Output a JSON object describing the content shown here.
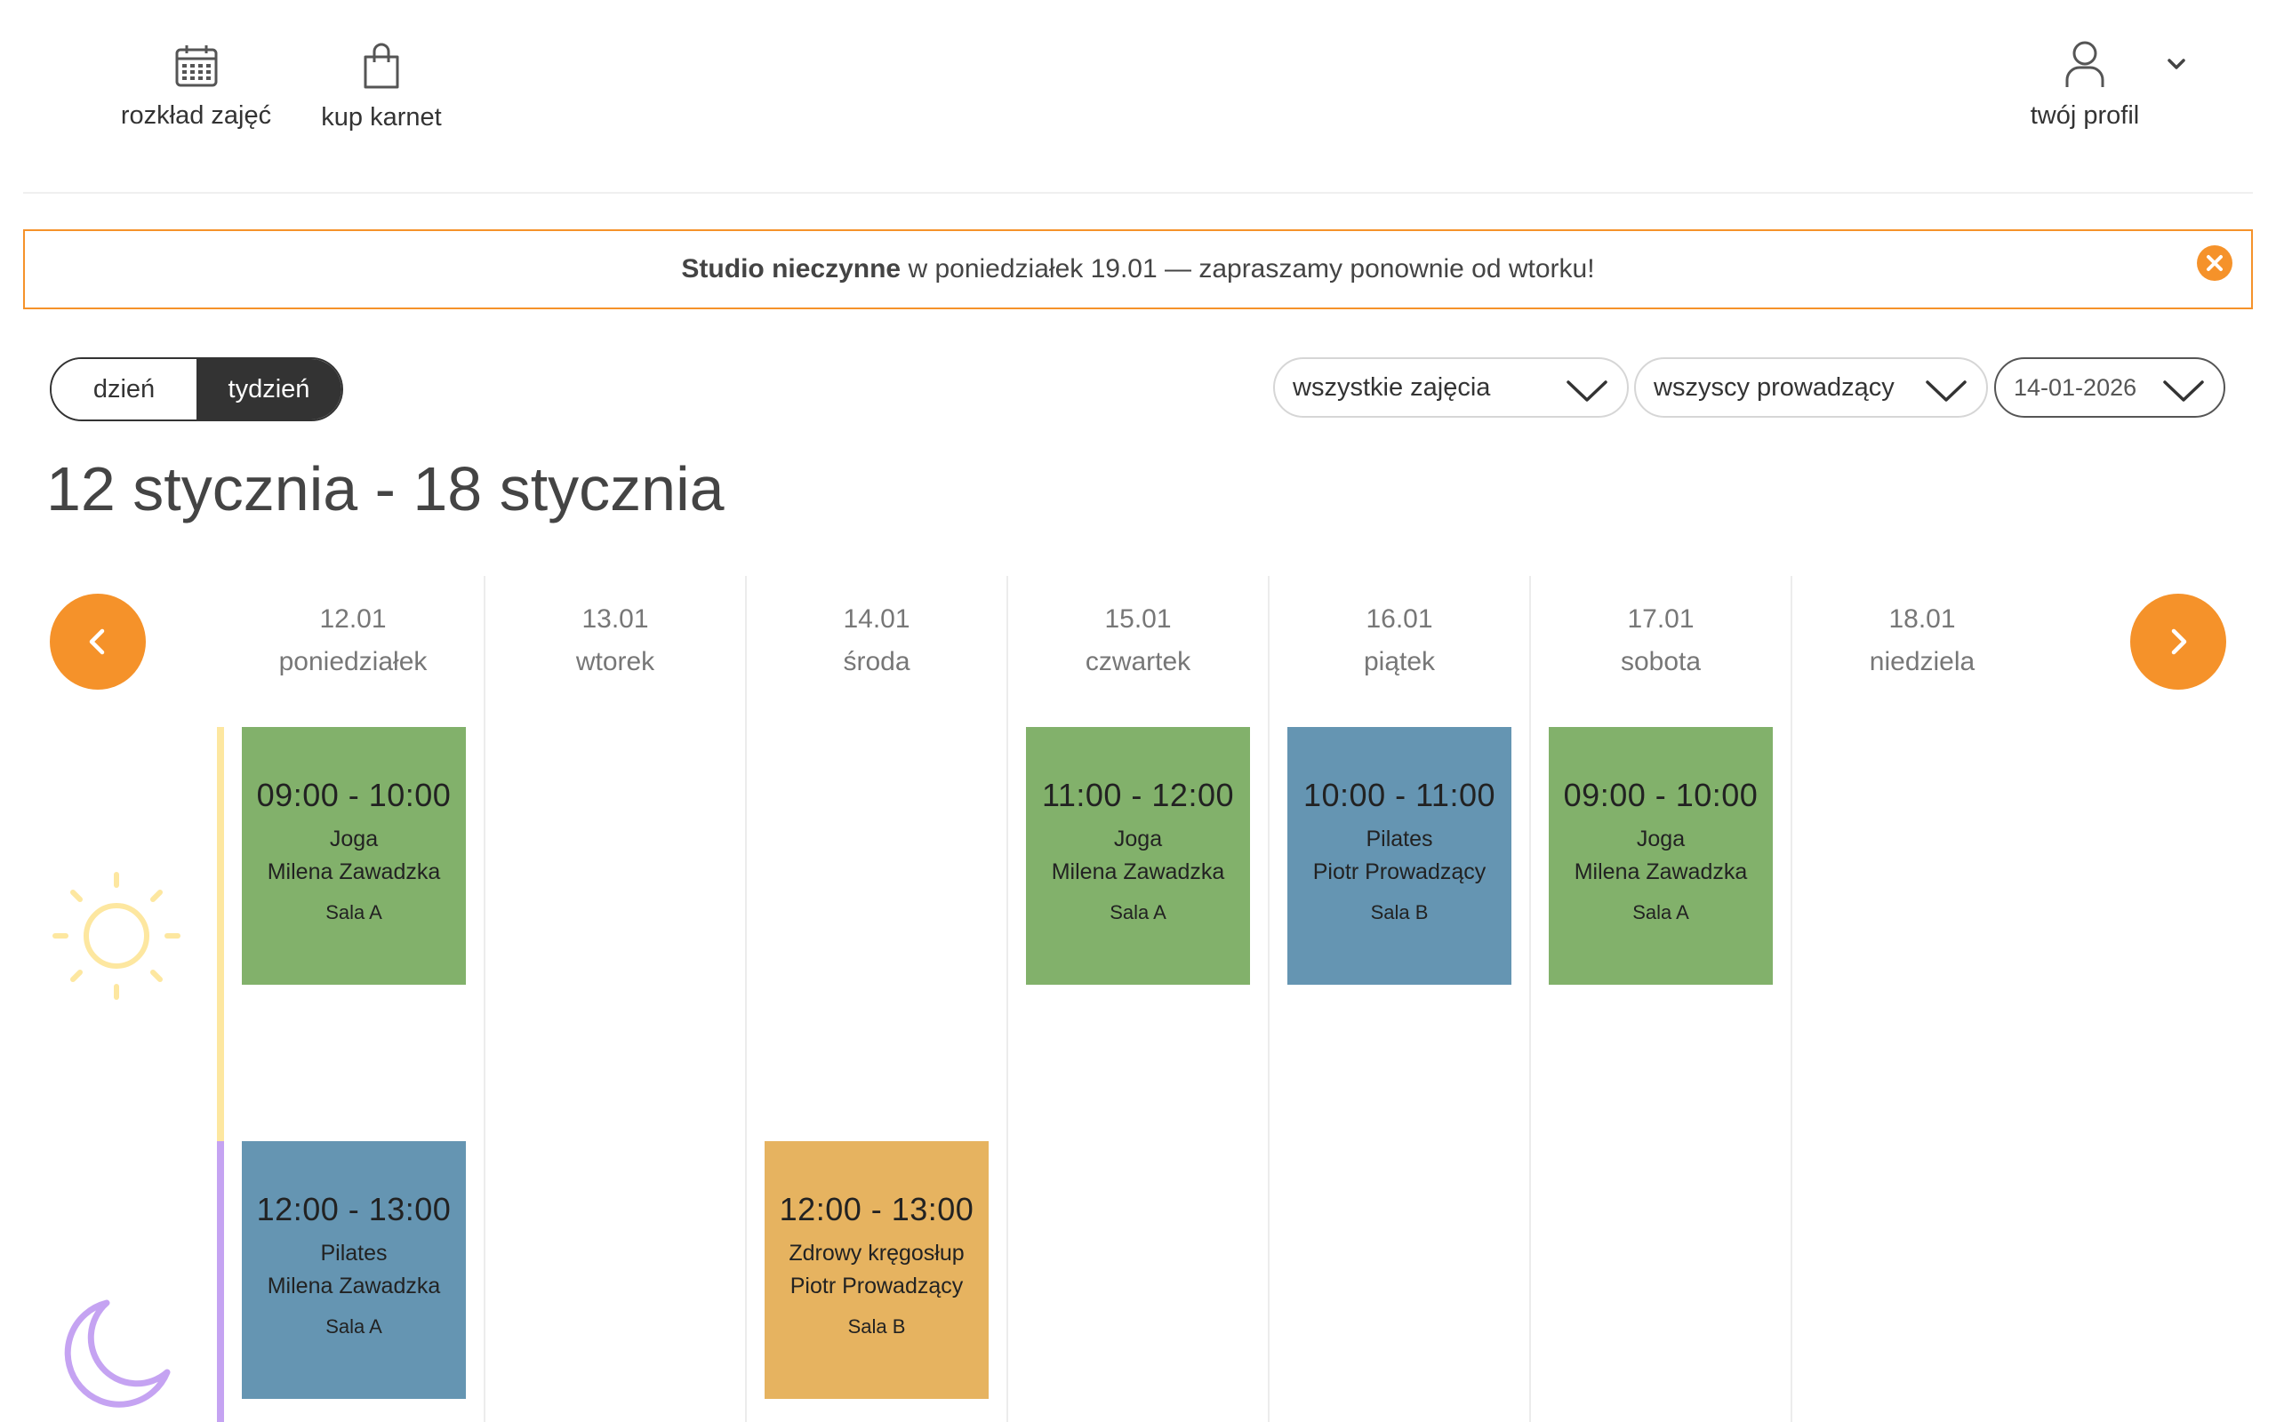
{
  "nav": {
    "schedule_label": "rozkład zajęć",
    "buy_pass_label": "kup karnet",
    "profile_label": "twój profil"
  },
  "alert": {
    "bold": "Studio nieczynne",
    "text": " w poniedziałek 19.01 — zapraszamy ponownie od wtorku!"
  },
  "view_toggle": {
    "day_label": "dzień",
    "week_label": "tydzień",
    "selected": "tydzień"
  },
  "filters": {
    "classes_value": "wszystkie zajęcia",
    "instructors_value": "wszyscy prowadzący",
    "date_value": "14-01-2026"
  },
  "week_title": "12 stycznia - 18 stycznia",
  "days": [
    {
      "date": "12.01",
      "name": "poniedziałek"
    },
    {
      "date": "13.01",
      "name": "wtorek"
    },
    {
      "date": "14.01",
      "name": "środa"
    },
    {
      "date": "15.01",
      "name": "czwartek"
    },
    {
      "date": "16.01",
      "name": "piątek"
    },
    {
      "date": "17.01",
      "name": "sobota"
    },
    {
      "date": "18.01",
      "name": "niedziela"
    }
  ],
  "events": [
    {
      "day": 0,
      "slot": "morning",
      "time": "09:00 - 10:00",
      "class": "Joga",
      "instructor": "Milena Zawadzka",
      "room": "Sala A",
      "color": "#82b16b"
    },
    {
      "day": 3,
      "slot": "morning",
      "time": "11:00 - 12:00",
      "class": "Joga",
      "instructor": "Milena Zawadzka",
      "room": "Sala A",
      "color": "#82b16b"
    },
    {
      "day": 4,
      "slot": "morning",
      "time": "10:00 - 11:00",
      "class": "Pilates",
      "instructor": "Piotr Prowadzący",
      "room": "Sala B",
      "color": "#6595b2"
    },
    {
      "day": 5,
      "slot": "morning",
      "time": "09:00 - 10:00",
      "class": "Joga",
      "instructor": "Milena Zawadzka",
      "room": "Sala A",
      "color": "#82b16b"
    },
    {
      "day": 0,
      "slot": "evening",
      "time": "12:00 - 13:00",
      "class": "Pilates",
      "instructor": "Milena Zawadzka",
      "room": "Sala A",
      "color": "#6595b2"
    },
    {
      "day": 2,
      "slot": "evening",
      "time": "12:00 - 13:00",
      "class": "Zdrowy kręgosłup",
      "instructor": "Piotr Prowadzący",
      "room": "Sala B",
      "color": "#e6b360"
    }
  ],
  "colors": {
    "accent": "#f5922a",
    "morning_bar": "#fde7a0",
    "evening_bar": "#c5a3f2",
    "toggle_active": "#333333"
  },
  "icons": {
    "schedule": "calendar-icon",
    "buy_pass": "shopping-bag-icon",
    "profile": "user-icon",
    "profile_menu": "chevron-down-icon",
    "alert_close": "close-icon",
    "prev": "chevron-left-icon",
    "next": "chevron-right-icon",
    "morning": "sun-icon",
    "evening": "moon-icon"
  }
}
